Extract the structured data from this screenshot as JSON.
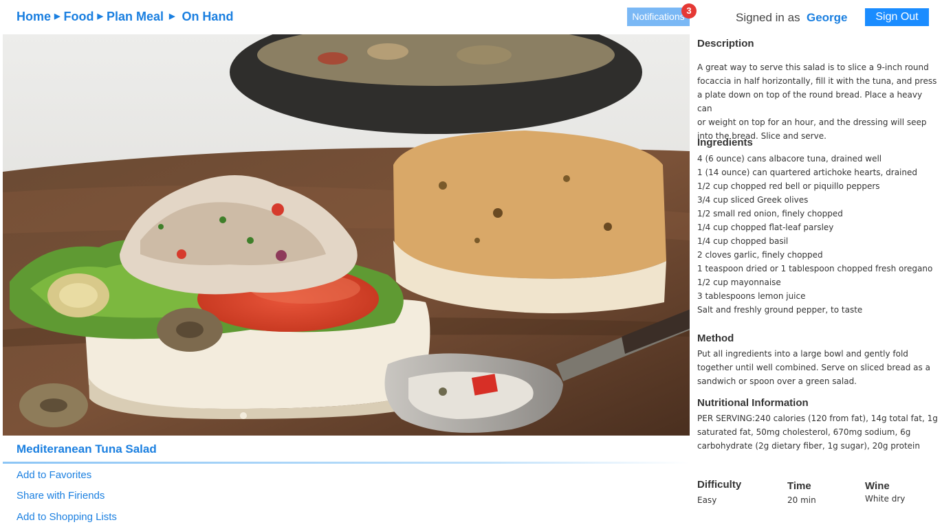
{
  "breadcrumb": [
    "Home",
    "Food",
    "Plan Meal",
    "On Hand"
  ],
  "header": {
    "notifications_label": "Notifications",
    "notifications_count": "3",
    "signed_in_label": "Signed in as",
    "user_name": "George",
    "sign_out_label": "Sign Out"
  },
  "recipe": {
    "title": "Mediteranean Tuna Salad",
    "actions": [
      "Add to Favorites",
      "Share with Firiends",
      "Add to Shopping Lists"
    ]
  },
  "details": {
    "description_heading": "Description",
    "description_lines": [
      "A great way to serve this salad is to slice a 9-inch round",
      "focaccia in half horizontally, fill it with the tuna, and press",
      "a plate down on top of the round bread. Place a heavy can",
      "or weight on top for an hour, and the dressing will seep",
      "into the bread. Slice and serve."
    ],
    "ingredients_heading": "Ingredients",
    "ingredients": [
      "4 (6 ounce) cans albacore tuna, drained well",
      "1 (14 ounce) can quartered artichoke hearts, drained",
      "1/2 cup chopped red bell or piquillo peppers",
      "3/4 cup sliced Greek olives",
      "1/2 small red onion, finely chopped",
      "1/4 cup chopped flat-leaf parsley",
      "1/4 cup chopped basil",
      "2 cloves garlic, finely chopped",
      "1 teaspoon dried or 1 tablespoon chopped fresh oregano",
      "1/2 cup mayonnaise",
      "3 tablespoons lemon juice",
      "Salt and freshly ground pepper, to taste"
    ],
    "method_heading": "Method",
    "method_lines": [
      "Put all ingredients into a large bowl and gently fold",
      "together until well combined. Serve on sliced bread as a",
      "sandwich or spoon over a green salad."
    ],
    "nutrition_heading": "Nutritional Information",
    "nutrition_lines": [
      "PER SERVING:240 calories (120 from fat), 14g total fat, 1g",
      "saturated fat, 50mg cholesterol, 670mg sodium, 6g",
      "carbohydrate (2g dietary fiber, 1g sugar), 20g protein"
    ]
  },
  "meta": {
    "difficulty_label": "Difficulty",
    "difficulty_value": "Easy",
    "time_label": "Time",
    "time_value": "20 min",
    "wine_label": "Wine",
    "wine_value": "White dry"
  },
  "colors": {
    "accent": "#1a7fe0",
    "button": "#1a8cff",
    "notifications_bg": "#7ab8f5",
    "badge": "#e53935"
  }
}
